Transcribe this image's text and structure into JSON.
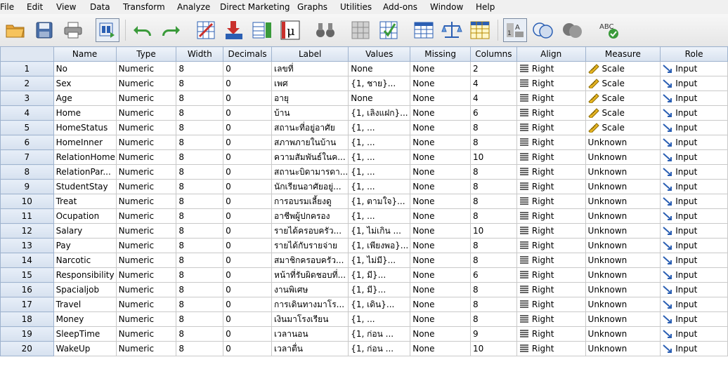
{
  "menu": [
    "File",
    "Edit",
    "View",
    "Data",
    "Transform",
    "Analyze",
    "Direct Marketing",
    "Graphs",
    "Utilities",
    "Add-ons",
    "Window",
    "Help"
  ],
  "toolbar": {
    "icons": [
      "open-folder-icon",
      "save-icon",
      "print-icon",
      "dialog-recall-icon",
      "undo-icon",
      "redo-icon",
      "go-to-case-icon",
      "go-to-variable-icon",
      "variables-icon",
      "run-descriptives-icon",
      "find-icon",
      "insert-cases-icon",
      "insert-variable-icon",
      "split-file-icon",
      "weight-cases-icon",
      "select-cases-icon",
      "value-labels-icon",
      "use-variable-sets-icon",
      "show-all-variables-icon",
      "spell-check-icon"
    ],
    "colors": {
      "blue": "#2b5fb3",
      "green": "#3a9a3a",
      "red": "#c9302c",
      "gray": "#8a8a8a"
    }
  },
  "grid": {
    "headers": [
      "Name",
      "Type",
      "Width",
      "Decimals",
      "Label",
      "Values",
      "Missing",
      "Columns",
      "Align",
      "Measure",
      "Role"
    ],
    "rows": [
      {
        "num": "1",
        "name": "No",
        "type": "Numeric",
        "width": "8",
        "decimals": "0",
        "label": "เลขที่",
        "values": "None",
        "missing": "None",
        "columns": "2",
        "align": "Right",
        "measure": "Scale",
        "measure_icon": "ruler-icon",
        "role": "Input"
      },
      {
        "num": "2",
        "name": "Sex",
        "type": "Numeric",
        "width": "8",
        "decimals": "0",
        "label": "เพศ",
        "values": "{1, ชาย}...",
        "missing": "None",
        "columns": "4",
        "align": "Right",
        "measure": "Scale",
        "measure_icon": "ruler-icon",
        "role": "Input"
      },
      {
        "num": "3",
        "name": "Age",
        "type": "Numeric",
        "width": "8",
        "decimals": "0",
        "label": "อายุ",
        "values": "None",
        "missing": "None",
        "columns": "4",
        "align": "Right",
        "measure": "Scale",
        "measure_icon": "ruler-icon",
        "role": "Input"
      },
      {
        "num": "4",
        "name": "Home",
        "type": "Numeric",
        "width": "8",
        "decimals": "0",
        "label": "บ้าน",
        "values": "{1, เลิงแฝก}...",
        "missing": "None",
        "columns": "6",
        "align": "Right",
        "measure": "Scale",
        "measure_icon": "ruler-icon",
        "role": "Input"
      },
      {
        "num": "5",
        "name": "HomeStatus",
        "type": "Numeric",
        "width": "8",
        "decimals": "0",
        "label": "สถานะที่อยู่อาศัย",
        "values": "{1, ...",
        "missing": "None",
        "columns": "8",
        "align": "Right",
        "measure": "Scale",
        "measure_icon": "ruler-icon",
        "role": "Input"
      },
      {
        "num": "6",
        "name": "HomeInner",
        "type": "Numeric",
        "width": "8",
        "decimals": "0",
        "label": "สภาพภายในบ้าน",
        "values": "{1, ...",
        "missing": "None",
        "columns": "8",
        "align": "Right",
        "measure": "Unknown",
        "measure_icon": "",
        "role": "Input"
      },
      {
        "num": "7",
        "name": "RelationHome",
        "type": "Numeric",
        "width": "8",
        "decimals": "0",
        "label": "ความสัมพันธ์ในค...",
        "values": "{1, ...",
        "missing": "None",
        "columns": "10",
        "align": "Right",
        "measure": "Unknown",
        "measure_icon": "",
        "role": "Input"
      },
      {
        "num": "8",
        "name": "RelationPar...",
        "type": "Numeric",
        "width": "8",
        "decimals": "0",
        "label": "สถานะบิดามารดา...",
        "values": "{1, ...",
        "missing": "None",
        "columns": "8",
        "align": "Right",
        "measure": "Unknown",
        "measure_icon": "",
        "role": "Input"
      },
      {
        "num": "9",
        "name": "StudentStay",
        "type": "Numeric",
        "width": "8",
        "decimals": "0",
        "label": "นักเรียนอาศัยอยู่...",
        "values": "{1, ...",
        "missing": "None",
        "columns": "8",
        "align": "Right",
        "measure": "Unknown",
        "measure_icon": "",
        "role": "Input"
      },
      {
        "num": "10",
        "name": "Treat",
        "type": "Numeric",
        "width": "8",
        "decimals": "0",
        "label": "การอบรมเลี้ยงดู",
        "values": "{1, ตามใจ}...",
        "missing": "None",
        "columns": "8",
        "align": "Right",
        "measure": "Unknown",
        "measure_icon": "",
        "role": "Input"
      },
      {
        "num": "11",
        "name": "Ocupation",
        "type": "Numeric",
        "width": "8",
        "decimals": "0",
        "label": "อาชีพผู้ปกครอง",
        "values": "{1, ...",
        "missing": "None",
        "columns": "8",
        "align": "Right",
        "measure": "Unknown",
        "measure_icon": "",
        "role": "Input"
      },
      {
        "num": "12",
        "name": "Salary",
        "type": "Numeric",
        "width": "8",
        "decimals": "0",
        "label": "รายได้ครอบครัว...",
        "values": "{1, ไม่เกิน ...",
        "missing": "None",
        "columns": "10",
        "align": "Right",
        "measure": "Unknown",
        "measure_icon": "",
        "role": "Input"
      },
      {
        "num": "13",
        "name": "Pay",
        "type": "Numeric",
        "width": "8",
        "decimals": "0",
        "label": "รายได้กับรายจ่าย",
        "values": "{1, เพียงพอ}...",
        "missing": "None",
        "columns": "8",
        "align": "Right",
        "measure": "Unknown",
        "measure_icon": "",
        "role": "Input"
      },
      {
        "num": "14",
        "name": "Narcotic",
        "type": "Numeric",
        "width": "8",
        "decimals": "0",
        "label": "สมาชิกครอบครัว...",
        "values": "{1, ไม่มี}...",
        "missing": "None",
        "columns": "8",
        "align": "Right",
        "measure": "Unknown",
        "measure_icon": "",
        "role": "Input"
      },
      {
        "num": "15",
        "name": "Responsibility",
        "type": "Numeric",
        "width": "8",
        "decimals": "0",
        "label": "หน้าที่รับผิดชอบที่...",
        "values": "{1, มี}...",
        "missing": "None",
        "columns": "6",
        "align": "Right",
        "measure": "Unknown",
        "measure_icon": "",
        "role": "Input"
      },
      {
        "num": "16",
        "name": "Spacialjob",
        "type": "Numeric",
        "width": "8",
        "decimals": "0",
        "label": "งานพิเศษ",
        "values": "{1, มี}...",
        "missing": "None",
        "columns": "8",
        "align": "Right",
        "measure": "Unknown",
        "measure_icon": "",
        "role": "Input"
      },
      {
        "num": "17",
        "name": "Travel",
        "type": "Numeric",
        "width": "8",
        "decimals": "0",
        "label": "การเดินทางมาโร...",
        "values": "{1, เดิน}...",
        "missing": "None",
        "columns": "8",
        "align": "Right",
        "measure": "Unknown",
        "measure_icon": "",
        "role": "Input"
      },
      {
        "num": "18",
        "name": "Money",
        "type": "Numeric",
        "width": "8",
        "decimals": "0",
        "label": "เงินมาโรงเรียน",
        "values": "{1, ...",
        "missing": "None",
        "columns": "8",
        "align": "Right",
        "measure": "Unknown",
        "measure_icon": "",
        "role": "Input"
      },
      {
        "num": "19",
        "name": "SleepTime",
        "type": "Numeric",
        "width": "8",
        "decimals": "0",
        "label": "เวลานอน",
        "values": "{1, ก่อน ...",
        "missing": "None",
        "columns": "9",
        "align": "Right",
        "measure": "Unknown",
        "measure_icon": "",
        "role": "Input"
      },
      {
        "num": "20",
        "name": "WakeUp",
        "type": "Numeric",
        "width": "8",
        "decimals": "0",
        "label": "เวลาตื่น",
        "values": "{1, ก่อน ...",
        "missing": "None",
        "columns": "10",
        "align": "Right",
        "measure": "Unknown",
        "measure_icon": "",
        "role": "Input"
      }
    ]
  }
}
